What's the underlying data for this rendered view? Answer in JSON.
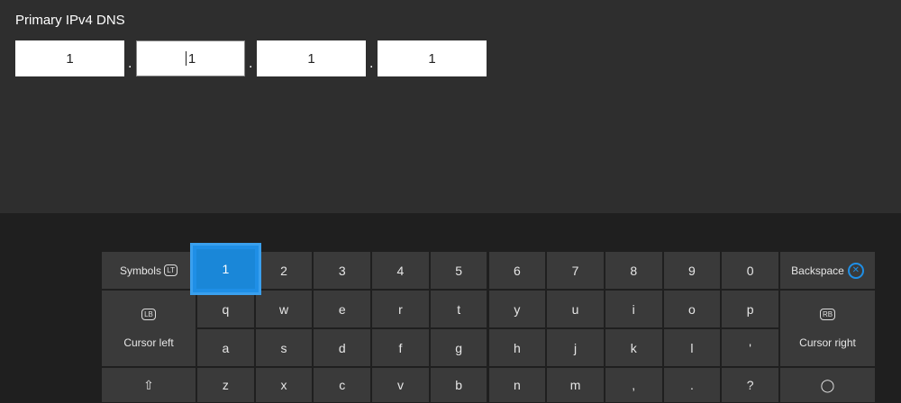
{
  "field": {
    "label": "Primary IPv4 DNS",
    "octets": [
      "1",
      "1",
      "1",
      "1"
    ],
    "separator": "."
  },
  "keyboard": {
    "symbols_label": "Symbols",
    "symbols_badge": "LT",
    "backspace_label": "Backspace",
    "backspace_icon": "x-button-icon",
    "cursor_left_label": "Cursor left",
    "cursor_left_badge": "LB",
    "cursor_right_label": "Cursor right",
    "cursor_right_badge": "RB",
    "row1": [
      "1",
      "2",
      "3",
      "4",
      "5",
      "6",
      "7",
      "8",
      "9",
      "0"
    ],
    "row2": [
      "q",
      "w",
      "e",
      "r",
      "t",
      "y",
      "u",
      "i",
      "o",
      "p"
    ],
    "row3": [
      "a",
      "s",
      "d",
      "f",
      "g",
      "h",
      "j",
      "k",
      "l",
      "'"
    ],
    "row4": [
      "z",
      "x",
      "c",
      "v",
      "b",
      "n",
      "m",
      ",",
      ".",
      "?"
    ],
    "focused_key": "1"
  },
  "colors": {
    "accent": "#1f8fe6",
    "panel": "#2e2e2e",
    "key": "#3a3a3a"
  }
}
